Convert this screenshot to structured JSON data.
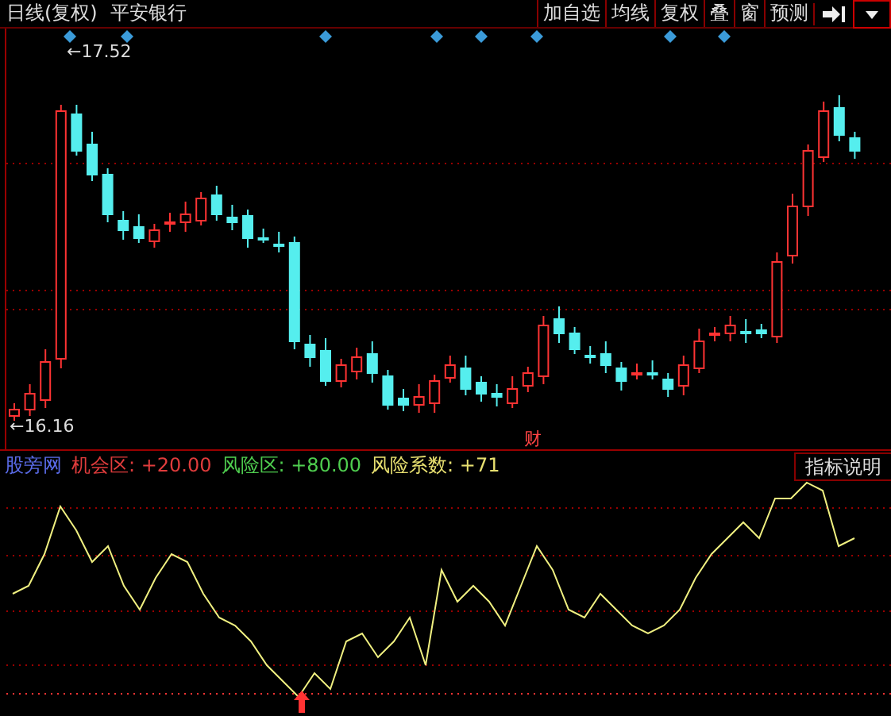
{
  "toolbar": {
    "period": "日线(复权)",
    "stock": "平安银行",
    "buttons": [
      {
        "label": "加自选"
      },
      {
        "label": "均线"
      },
      {
        "label": "复权"
      },
      {
        "label": "叠"
      },
      {
        "label": "窗"
      },
      {
        "label": "预测"
      }
    ]
  },
  "price_chart": {
    "high_label": "←17.52",
    "low_label": "←16.16",
    "event_marker": "财"
  },
  "indicator": {
    "name": "股旁网",
    "items": [
      {
        "label": "机会区:",
        "value": "+20.00",
        "color": "#e03c3c"
      },
      {
        "label": "风险区:",
        "value": "+80.00",
        "color": "#4fce4f"
      },
      {
        "label": "风险系数:",
        "value": "+71",
        "color": "#e8e070"
      }
    ],
    "help_button": "指标说明"
  }
}
